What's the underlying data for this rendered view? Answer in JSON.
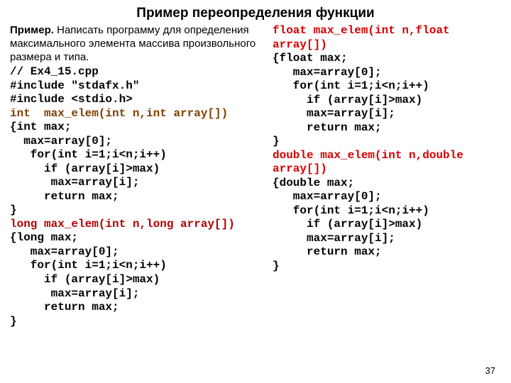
{
  "title": "Пример переопределения функции",
  "intro_bold": "Пример.",
  "intro_rest": " Написать программу для определения максимального элемента массива произвольного размера и типа.",
  "left": {
    "l1": "// Ex4_15.cpp",
    "l2": "#include \"stdafx.h\"",
    "l3": "#include <stdio.h>",
    "sig1": "int  max_elem(int n,int array[])",
    "b1_1": "{int max;",
    "b1_2": "  max=array[0];",
    "b1_3": "   for(int i=1;i<n;i++)",
    "b1_4": "     if (array[i]>max)",
    "b1_5": "      max=array[i];",
    "b1_6": "     return max;",
    "b1_7": "}",
    "sig2": "long max_elem(int n,long array[])",
    "b2_1": "{long max;",
    "b2_2": "   max=array[0];",
    "b2_3": "   for(int i=1;i<n;i++)",
    "b2_4": "     if (array[i]>max)",
    "b2_5": "      max=array[i];",
    "b2_6": "     return max;",
    "b2_7": "}"
  },
  "right": {
    "sig3a": "float max_elem(int n,float",
    "sig3b": "array[])",
    "b3_1": "{float max;",
    "b3_2": "   max=array[0];",
    "b3_3": "   for(int i=1;i<n;i++)",
    "b3_4": "     if (array[i]>max)",
    "b3_5": "     max=array[i];",
    "b3_6": "     return max;",
    "b3_7": "}",
    "sig4a": "double max_elem(int n,double",
    "sig4b": "array[])",
    "b4_1": "{double max;",
    "b4_2": "   max=array[0];",
    "b4_3": "   for(int i=1;i<n;i++)",
    "b4_4": "     if (array[i]>max)",
    "b4_5": "     max=array[i];",
    "b4_6": "     return max;",
    "b4_7": "}"
  },
  "pagenum": "37"
}
